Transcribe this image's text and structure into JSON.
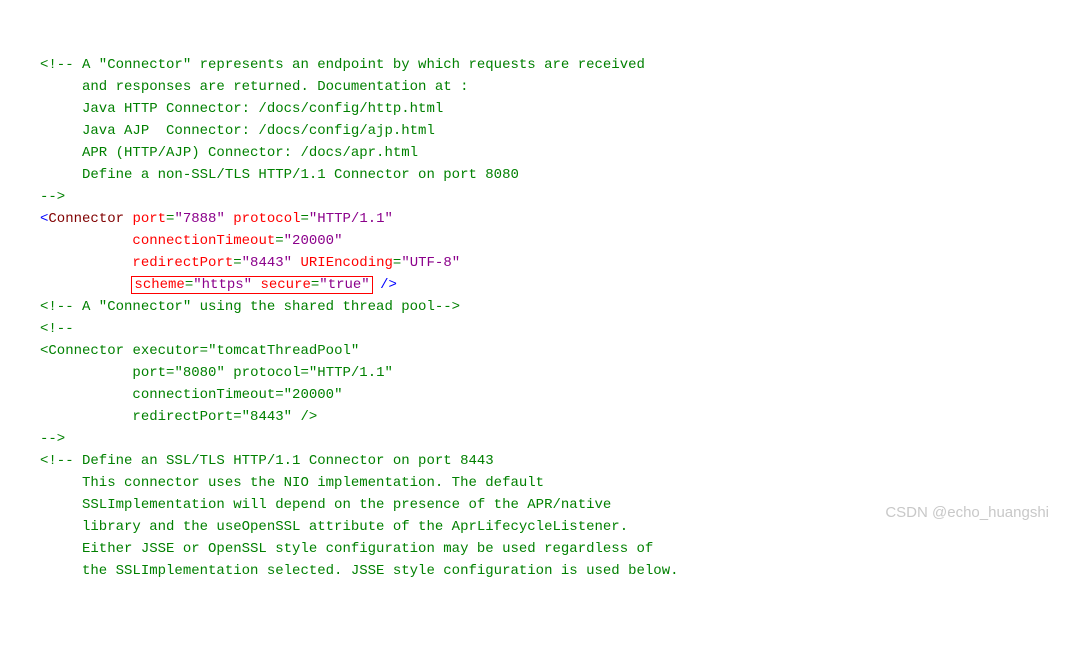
{
  "comment1": {
    "l1": "<!-- A \"Connector\" represents an endpoint by which requests are received",
    "l2": "     and responses are returned. Documentation at :",
    "l3": "     Java HTTP Connector: /docs/config/http.html",
    "l4": "     Java AJP  Connector: /docs/config/ajp.html",
    "l5": "     APR (HTTP/AJP) Connector: /docs/apr.html",
    "l6": "     Define a non-SSL/TLS HTTP/1.1 Connector on port 8080",
    "l7": "-->"
  },
  "connector1": {
    "tag": "Connector",
    "port_attr": "port",
    "port_val": "\"7888\"",
    "protocol_attr": "protocol",
    "protocol_val": "\"HTTP/1.1\"",
    "ct_attr": "connectionTimeout",
    "ct_val": "\"20000\"",
    "rp_attr": "redirectPort",
    "rp_val": "\"8443\"",
    "uri_attr": "URIEncoding",
    "uri_val": "\"UTF-8\"",
    "scheme_attr": "scheme",
    "scheme_val": "\"https\"",
    "secure_attr": "secure",
    "secure_val": "\"true\""
  },
  "comment2": "<!-- A \"Connector\" using the shared thread pool-->",
  "comment3_open": "<!--",
  "connector2": {
    "tag": "Connector",
    "exec_attr": "executor",
    "exec_val": "\"tomcatThreadPool\"",
    "port_attr": "port",
    "port_val": "\"8080\"",
    "protocol_attr": "protocol",
    "protocol_val": "\"HTTP/1.1\"",
    "ct_attr": "connectionTimeout",
    "ct_val": "\"20000\"",
    "rp_attr": "redirectPort",
    "rp_val": "\"8443\""
  },
  "comment3_close": "-->",
  "comment4": {
    "l1": "<!-- Define an SSL/TLS HTTP/1.1 Connector on port 8443",
    "l2": "     This connector uses the NIO implementation. The default",
    "l3": "     SSLImplementation will depend on the presence of the APR/native",
    "l4": "     library and the useOpenSSL attribute of the AprLifecycleListener.",
    "l5": "     Either JSSE or OpenSSL style configuration may be used regardless of",
    "l6": "     the SSLImplementation selected. JSSE style configuration is used below."
  },
  "watermark": "CSDN @echo_huangshi"
}
